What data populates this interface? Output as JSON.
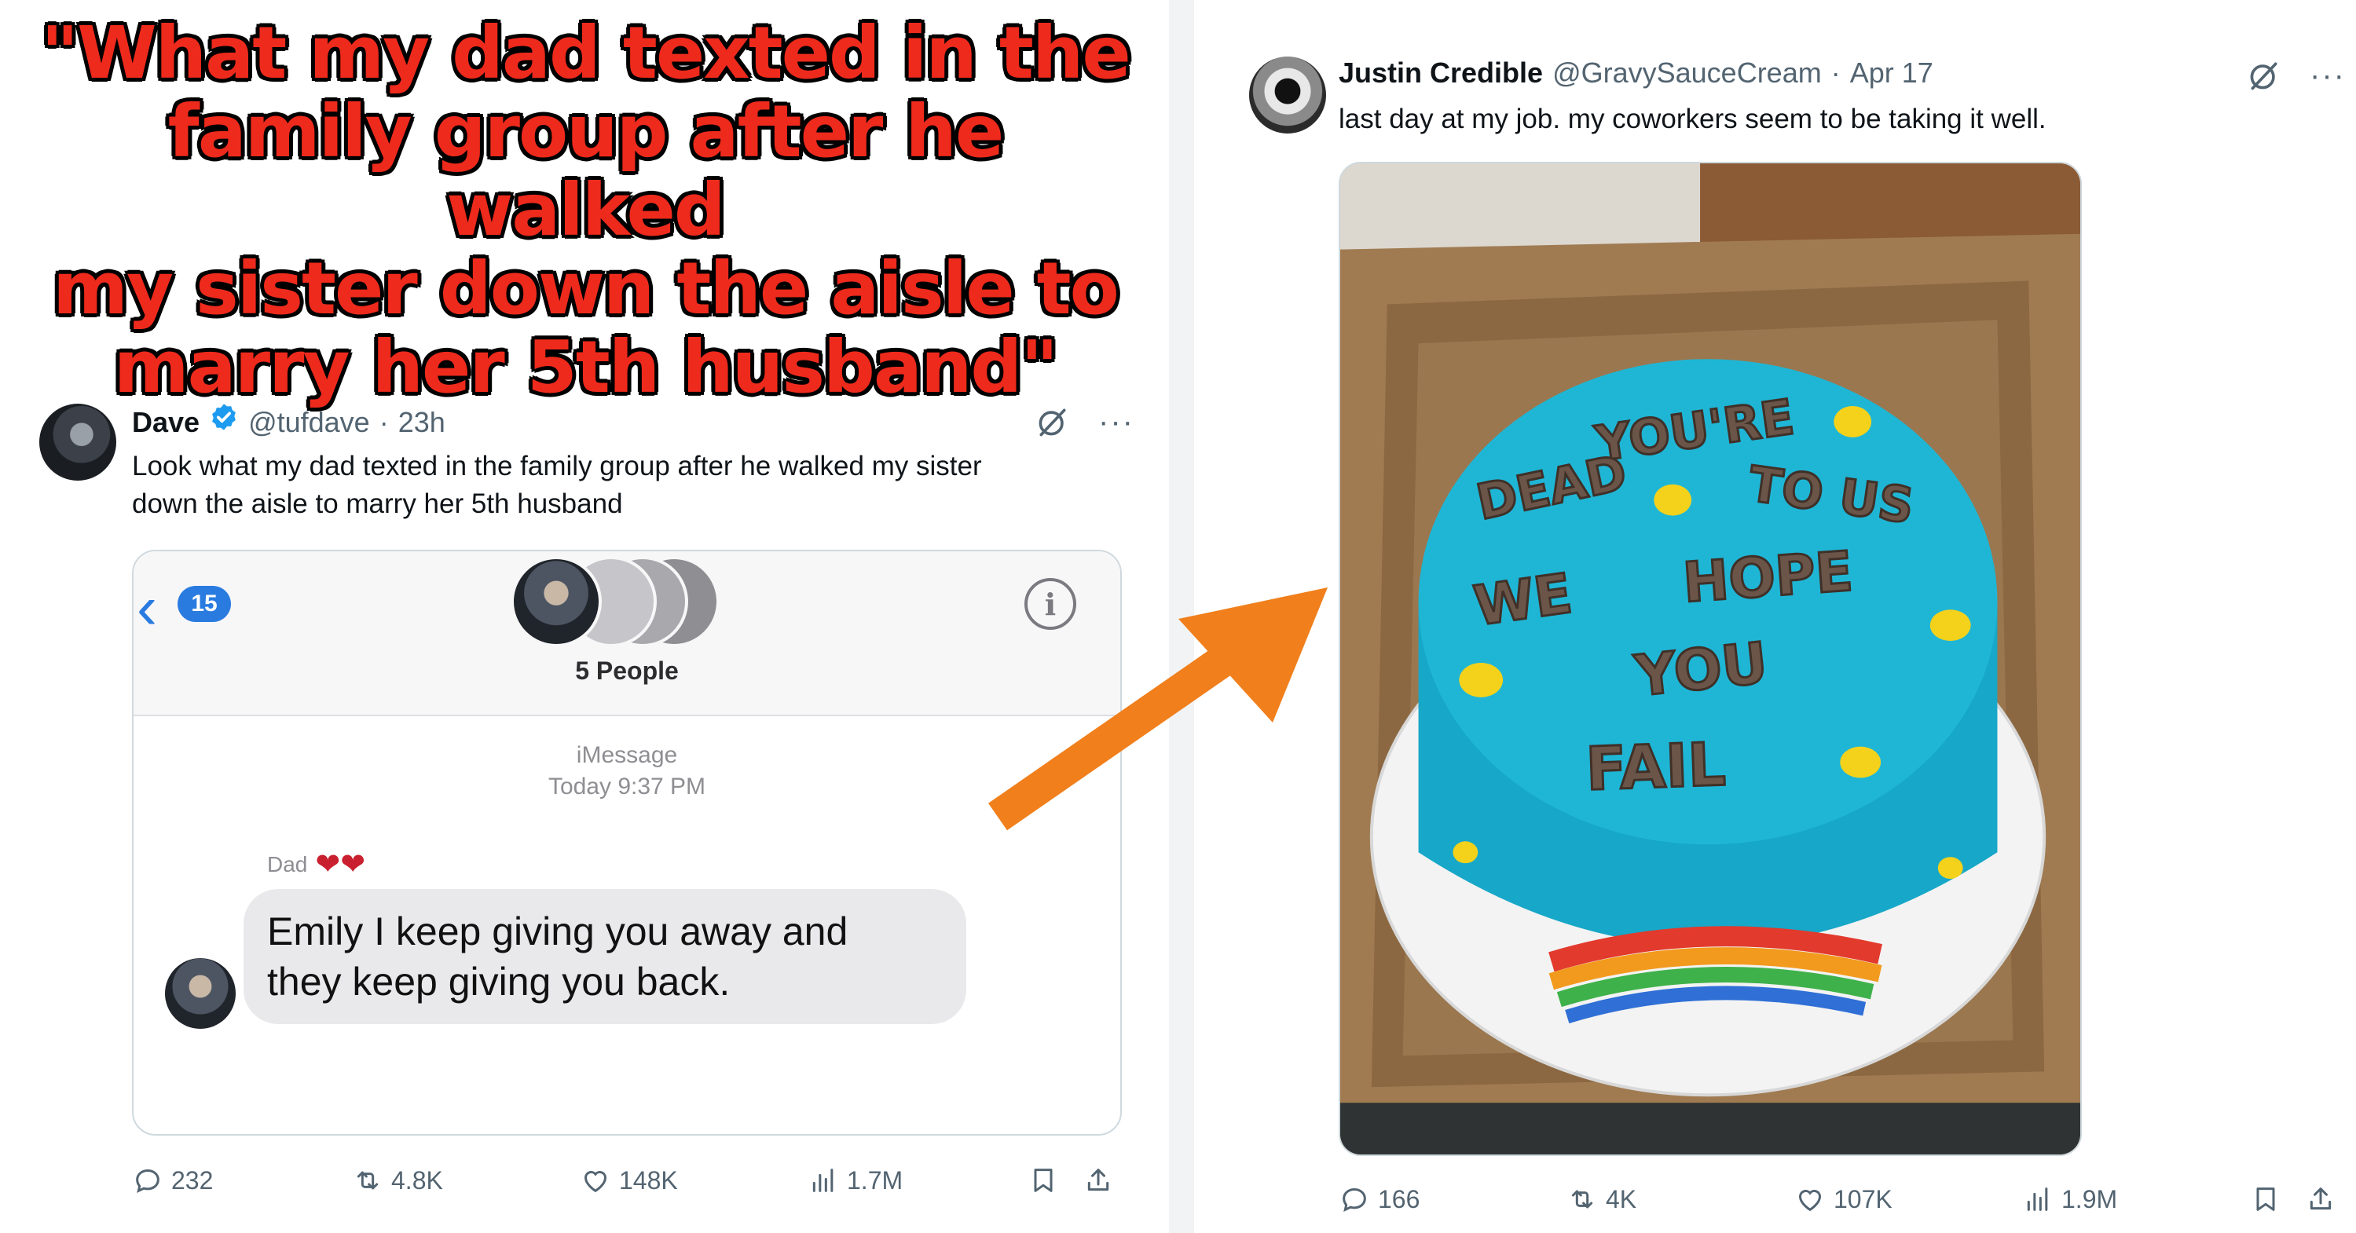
{
  "headline": {
    "lines": [
      "\"What my dad texted in the",
      "family group after he walked",
      "my sister down the aisle to",
      "marry her 5th husband\""
    ]
  },
  "tweet_left": {
    "name": "Dave",
    "handle": "@tufdave",
    "separator": "·",
    "time": "23h",
    "verified": true,
    "text_lines": [
      "Look what my dad texted in the family group after he walked my sister",
      "down the aisle to marry her 5th husband"
    ],
    "media": {
      "back_count": "15",
      "group_label": "5 People",
      "service": "iMessage",
      "timestamp": "Today 9:37 PM",
      "sender": "Dad",
      "sender_hearts": "❤❤",
      "message_lines": [
        "Emily I keep giving you away and",
        "they keep giving you back."
      ]
    },
    "stats": {
      "replies": "232",
      "reposts": "4.8K",
      "likes": "148K",
      "views": "1.7M"
    }
  },
  "tweet_right": {
    "name": "Justin Credible",
    "handle": "@GravySauceCream",
    "separator": "·",
    "time": "Apr 17",
    "text": "last day at my job. my coworkers seem to be taking it well.",
    "media": {
      "cake_lines": [
        "YOU'RE",
        "DEAD",
        "TO US",
        "WE",
        "HOPE",
        "YOU",
        "FAIL"
      ]
    },
    "stats": {
      "replies": "166",
      "reposts": "4K",
      "likes": "107K",
      "views": "1.9M"
    }
  },
  "colors": {
    "headline_red": "#ee2a1c",
    "arrow_orange": "#f07f1c",
    "verified_blue": "#1d9bf0",
    "imessage_blue": "#2a7be0",
    "cake_blue": "#1fb6d6",
    "box_brown": "#a07b52"
  },
  "icons": [
    "grok-icon",
    "more-icon",
    "reply-icon",
    "repost-icon",
    "like-icon",
    "views-icon",
    "bookmark-icon",
    "share-icon",
    "verified-icon",
    "info-icon",
    "back-chevron-icon"
  ]
}
